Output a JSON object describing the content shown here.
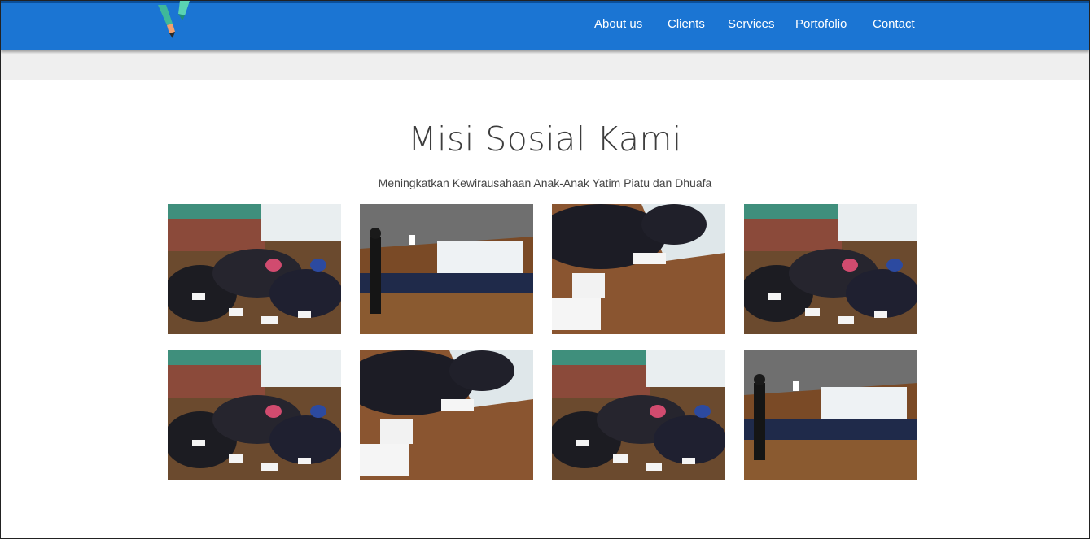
{
  "brand": {
    "logo_icon": "v-logo-icon"
  },
  "nav": {
    "items": [
      {
        "label": "About us"
      },
      {
        "label": "Clients"
      },
      {
        "label": "Services"
      },
      {
        "label": "Portofolio"
      },
      {
        "label": "Contact"
      }
    ]
  },
  "section": {
    "title": "Misi Sosial Kami",
    "subtitle": "Meningkatkan Kewirausahaan Anak-Anak Yatim Piatu dan Dhuafa"
  },
  "gallery": {
    "photos": [
      {
        "scene": "students-writing-on-floor"
      },
      {
        "scene": "presenter-with-audience"
      },
      {
        "scene": "students-close-up-papers"
      },
      {
        "scene": "students-writing-on-floor"
      },
      {
        "scene": "students-writing-on-floor"
      },
      {
        "scene": "students-close-up-papers"
      },
      {
        "scene": "students-writing-on-floor"
      },
      {
        "scene": "presenter-with-audience"
      }
    ]
  },
  "colors": {
    "navbar": "#1b75d3",
    "subbar": "#efefef",
    "title": "#3d3d3d"
  }
}
